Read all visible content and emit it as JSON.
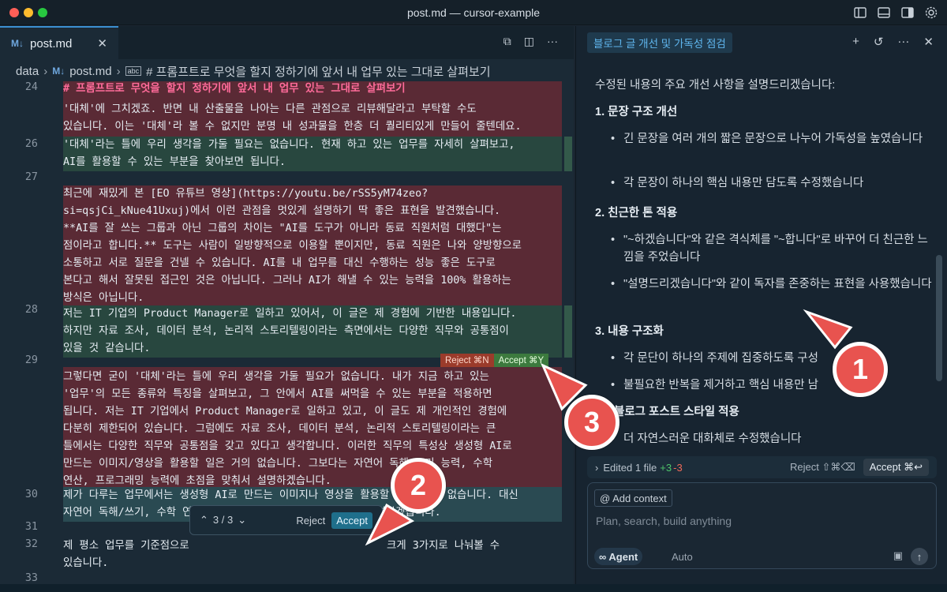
{
  "window": {
    "title": "post.md — cursor-example"
  },
  "editor": {
    "tab": {
      "icon": "M↓",
      "label": "post.md",
      "close": "✕"
    },
    "breadcrumb": {
      "folder": "data",
      "file_icon": "M↓",
      "file": "post.md",
      "symbol_icon": "abc",
      "symbol": "# 프롬프트로 무엇을 할지 정하기에 앞서 내 업무 있는 그대로 살펴보기"
    },
    "line_numbers": [
      "24",
      "26",
      "27",
      "28",
      "29",
      "30",
      "31",
      "32",
      "33"
    ],
    "lines": {
      "l24": "# 프롬프트로 무엇을 할지 정하기에 앞서 내 업무 있는 그대로 살펴보기",
      "r1": "'대체'에 그치겠죠. 반면 내 산출물을 나아는 다른 관점으로 리뷰해달라고 부탁할 수도",
      "r2": "있습니다. 이는 '대체'라 볼 수 없지만 분명 내 성과물을 한층 더 퀄리티있게 만들어 줄텐데요.",
      "g26a": "'대체'라는 틀에 우리 생각을 가둘 필요는 없습니다. 현재 하고 있는 업무를 자세히 살펴보고,",
      "g26b": "AI를 활용할 수 있는 부분을 찾아보면 됩니다.",
      "r27a": "최근에 재밌게 본 [EO 유튜브 영상](https://youtu.be/rSS5yM74zeo?",
      "r27b": "si=qsjCi_kNue41Uxuj)에서 이런 관점을 멋있게 설명하기 딱 좋은 표현을 발견했습니다.",
      "r27c": "**AI를 잘 쓰는 그룹과 아닌 그룹의 차이는 \"AI를 도구가 아니라 동료 직원처럼 대했다\"는",
      "r27d": "점이라고 합니다.** 도구는 사람이 일방향적으로 이용할 뿐이지만, 동료 직원은 나와 양방향으로",
      "r27e": "소통하고 서로 질문을 건넬 수 있습니다. AI를 내 업무를 대신 수행하는 성능 좋은 도구로",
      "r27f": "본다고 해서 잘못된 접근인 것은 아닙니다. 그러나 AI가 해낼 수 있는 능력을 100% 활용하는",
      "r27g": "방식은 아닙니다.",
      "g28a": "저는 IT 기업의 Product Manager로 일하고 있어서, 이 글은 제 경험에 기반한 내용입니다.",
      "g28b": "하지만 자료 조사, 데이터 분석, 논리적 스토리텔링이라는 측면에서는 다양한 직무와 공통점이",
      "g28c": "있을 것 같습니다.",
      "r29a": "그렇다면 굳이 '대체'라는 틀에 우리 생각을 가둘 필요가 없습니다. 내가 지금 하고 있는",
      "r29b": "'업무'의 모든 종류와 특징을 살펴보고, 그 안에서 AI를 써먹을 수 있는 부분을 적용하면",
      "r29c": "됩니다. 저는 IT 기업에서 Product Manager로 일하고 있고, 이 글도 제 개인적인 경험에",
      "r29d": "다분히 제한되어 있습니다. 그럼에도 자료 조사, 데이터 분석, 논리적 스토리텔링이라는 큰",
      "r29e": "틀에서는 다양한 직무와 공통점을 갖고 있다고 생각합니다. 이러한 직무의 특성상 생성형 AI로",
      "r29f": "만드는 이미지/영상을 활용할 일은 거의 없습니다. 그보다는 자연어 독해/쓰기 능력, 수학",
      "r29g": "연산, 프로그래밍 능력에 초점을 맞춰서 설명하겠습니다.",
      "t30a": "제가 다루는 업무에서는 생성형 AI로 만드는 이미지나 영상을 활용할 일이 거의 없습니다. 대신",
      "t30b": "자연어 독해/쓰기, 수학 연산, 프로그래밍 능력에 초점을 맞춰 설명하겠습니다.",
      "l32a": "제 평소 업무를 기준점으로",
      "l32a_tail": "크게 3가지로 나눠볼 수",
      "l32b": "있습니다."
    },
    "inline_diff": {
      "reject": "Reject ⌘N",
      "accept": "Accept ⌘Y"
    },
    "diff_nav": {
      "position": "3 / 3",
      "reject": "Reject",
      "accept": "Accept"
    }
  },
  "chat": {
    "tab_title": "블로그 글 개선 및 가독성 점검",
    "intro": "수정된 내용의 주요 개선 사항을 설명드리겠습니다:",
    "sections": [
      {
        "title": "1. 문장 구조 개선",
        "bullets": [
          "긴 문장을 여러 개의 짧은 문장으로 나누어 가독성을 높였습니다",
          "각 문장이 하나의 핵심 내용만 담도록 수정했습니다"
        ]
      },
      {
        "title": "2. 친근한 톤 적용",
        "bullets": [
          "\"~하겠습니다\"와 같은 격식체를 \"~합니다\"로 바꾸어 더 친근한 느낌을 주었습니다",
          "\"설명드리겠습니다\"와 같이 독자를 존중하는 표현을 사용했습니다"
        ]
      },
      {
        "title": "3. 내용 구조화",
        "bullets": [
          "각 문단이 하나의 주제에 집중하도록 구성",
          "불필요한 반복을 제거하고 핵심 내용만 남"
        ]
      },
      {
        "title": "블로그 포스트 스타일 적용",
        "bullets": [
          "더 자연스러운 대화체로 수정했습니다"
        ]
      }
    ],
    "edited": {
      "label": "Edited 1 file",
      "added": "+3",
      "removed": "-3",
      "reject": "Reject ⇧⌘⌫",
      "accept": "Accept ⌘↩"
    },
    "composer": {
      "context_button": "@ Add context",
      "placeholder": "Plan, search, build anything",
      "mode": "∞ Agent",
      "model": "Auto"
    }
  },
  "annotations": [
    "1",
    "2",
    "3"
  ],
  "colors": {
    "badge": "#e8534f",
    "accent": "#3b8fd1",
    "deleted_bg": "#5a2a35",
    "added_bg": "#28473f"
  }
}
